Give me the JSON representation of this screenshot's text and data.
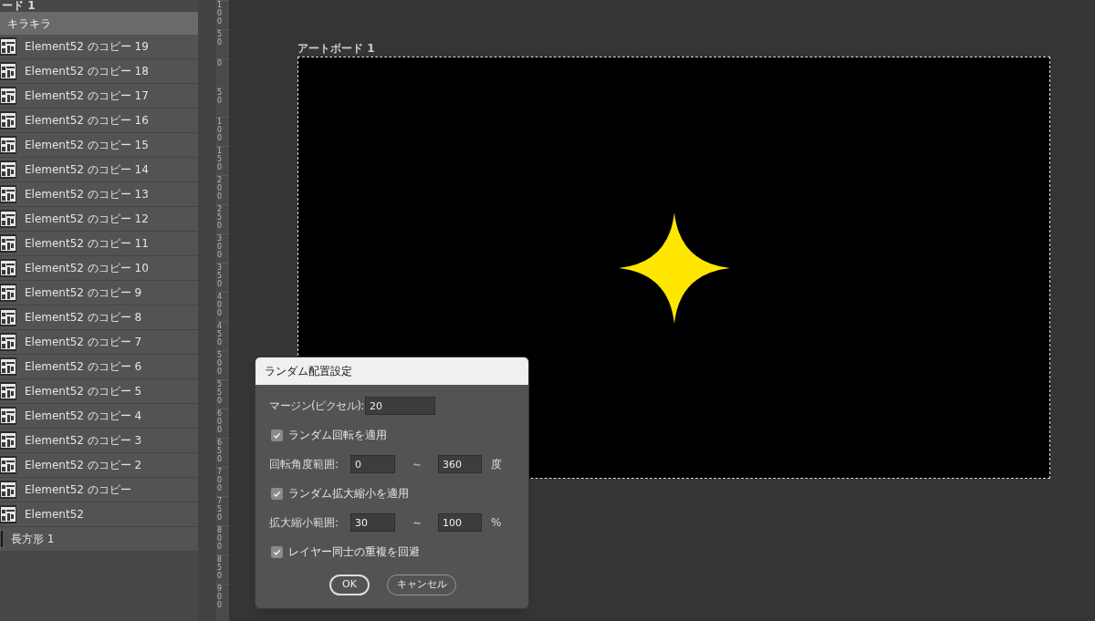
{
  "layers_panel": {
    "artboard_label": "ード 1",
    "group": {
      "name": "キラキラ",
      "selected": true
    },
    "layers": [
      {
        "name": "Element52 のコピー 19",
        "kind": "element"
      },
      {
        "name": "Element52 のコピー 18",
        "kind": "element"
      },
      {
        "name": "Element52 のコピー 17",
        "kind": "element"
      },
      {
        "name": "Element52 のコピー 16",
        "kind": "element"
      },
      {
        "name": "Element52 のコピー 15",
        "kind": "element"
      },
      {
        "name": "Element52 のコピー 14",
        "kind": "element"
      },
      {
        "name": "Element52 のコピー 13",
        "kind": "element"
      },
      {
        "name": "Element52 のコピー 12",
        "kind": "element"
      },
      {
        "name": "Element52 のコピー 11",
        "kind": "element"
      },
      {
        "name": "Element52 のコピー 10",
        "kind": "element"
      },
      {
        "name": "Element52 のコピー 9",
        "kind": "element"
      },
      {
        "name": "Element52 のコピー 8",
        "kind": "element"
      },
      {
        "name": "Element52 のコピー 7",
        "kind": "element"
      },
      {
        "name": "Element52 のコピー 6",
        "kind": "element"
      },
      {
        "name": "Element52 のコピー 5",
        "kind": "element"
      },
      {
        "name": "Element52 のコピー 4",
        "kind": "element"
      },
      {
        "name": "Element52 のコピー 3",
        "kind": "element"
      },
      {
        "name": "Element52 のコピー 2",
        "kind": "element"
      },
      {
        "name": "Element52 のコピー",
        "kind": "element"
      },
      {
        "name": "Element52",
        "kind": "element"
      },
      {
        "name": "長方形 1",
        "kind": "shape"
      }
    ]
  },
  "ruler": {
    "labels": [
      "100",
      "50",
      "0",
      "50",
      "100",
      "150",
      "200",
      "250",
      "300",
      "350",
      "400",
      "450",
      "500",
      "550",
      "600",
      "650",
      "700",
      "750",
      "800",
      "850",
      "900"
    ]
  },
  "artboard": {
    "title": "アートボード 1"
  },
  "dialog": {
    "title": "ランダム配置設定",
    "margin": {
      "label": "マージン(ピクセル):",
      "value": "20"
    },
    "rotate": {
      "label": "ランダム回転を適用",
      "checked": true
    },
    "rotate_range": {
      "label": "回転角度範囲:",
      "min": "0",
      "separator": "～",
      "max": "360",
      "unit": "度"
    },
    "scale": {
      "label": "ランダム拡大縮小を適用",
      "checked": true
    },
    "scale_range": {
      "label": "拡大縮小範囲:",
      "min": "30",
      "separator": "～",
      "max": "100",
      "unit": "%"
    },
    "overlap": {
      "label": "レイヤー同士の重複を回避",
      "checked": true
    },
    "buttons": [
      "OK",
      "キャンセル"
    ]
  }
}
